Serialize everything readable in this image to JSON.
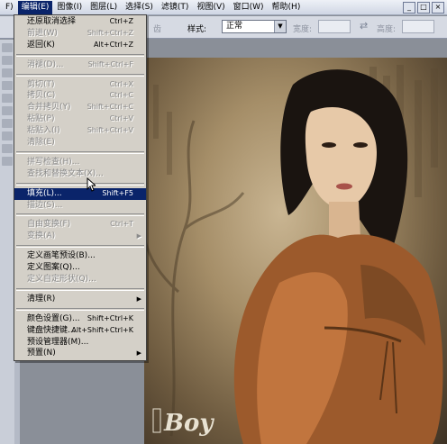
{
  "menubar": {
    "items": [
      {
        "label": "F)"
      },
      {
        "label": "编辑(E)"
      },
      {
        "label": "图像(I)"
      },
      {
        "label": "图层(L)"
      },
      {
        "label": "选择(S)"
      },
      {
        "label": "滤镜(T)"
      },
      {
        "label": "视图(V)"
      },
      {
        "label": "窗口(W)"
      },
      {
        "label": "帮助(H)"
      }
    ]
  },
  "options": {
    "cut_label": "齿",
    "style_label": "样式:",
    "style_value": "正常",
    "width_label": "宽度:",
    "height_label": "高度:"
  },
  "edit_menu": {
    "items": [
      {
        "label": "还原取消选择",
        "shortcut": "Ctrl+Z",
        "disabled": false
      },
      {
        "label": "前进(W)",
        "shortcut": "Shift+Ctrl+Z",
        "disabled": true
      },
      {
        "label": "返回(K)",
        "shortcut": "Alt+Ctrl+Z",
        "disabled": false
      },
      {
        "sep": true
      },
      {
        "label": "消褪(D)...",
        "shortcut": "Shift+Ctrl+F",
        "disabled": true
      },
      {
        "sep": true
      },
      {
        "label": "剪切(T)",
        "shortcut": "Ctrl+X",
        "disabled": true
      },
      {
        "label": "拷贝(C)",
        "shortcut": "Ctrl+C",
        "disabled": true
      },
      {
        "label": "合并拷贝(Y)",
        "shortcut": "Shift+Ctrl+C",
        "disabled": true
      },
      {
        "label": "粘贴(P)",
        "shortcut": "Ctrl+V",
        "disabled": true
      },
      {
        "label": "粘贴入(I)",
        "shortcut": "Shift+Ctrl+V",
        "disabled": true
      },
      {
        "label": "清除(E)",
        "shortcut": "",
        "disabled": true
      },
      {
        "sep": true
      },
      {
        "label": "拼写检查(H)...",
        "shortcut": "",
        "disabled": true
      },
      {
        "label": "查找和替换文本(X)...",
        "shortcut": "",
        "disabled": true
      },
      {
        "sep": true
      },
      {
        "label": "填充(L)...",
        "shortcut": "Shift+F5",
        "disabled": false,
        "highlight": true
      },
      {
        "label": "描边(S)...",
        "shortcut": "",
        "disabled": true
      },
      {
        "sep": true
      },
      {
        "label": "自由变换(F)",
        "shortcut": "Ctrl+T",
        "disabled": true
      },
      {
        "label": "变换(A)",
        "shortcut": "",
        "disabled": true,
        "submenu": true
      },
      {
        "sep": true
      },
      {
        "label": "定义画笔预设(B)...",
        "shortcut": "",
        "disabled": false
      },
      {
        "label": "定义图案(Q)...",
        "shortcut": "",
        "disabled": false
      },
      {
        "label": "定义自定形状(Q)...",
        "shortcut": "",
        "disabled": true
      },
      {
        "sep": true
      },
      {
        "label": "清理(R)",
        "shortcut": "",
        "disabled": false,
        "submenu": true
      },
      {
        "sep": true
      },
      {
        "label": "颜色设置(G)...",
        "shortcut": "Shift+Ctrl+K",
        "disabled": false
      },
      {
        "label": "键盘快捷键...",
        "shortcut": "Alt+Shift+Ctrl+K",
        "disabled": false
      },
      {
        "label": "预设管理器(M)...",
        "shortcut": "",
        "disabled": false
      },
      {
        "label": "预置(N)",
        "shortcut": "",
        "disabled": false,
        "submenu": true
      }
    ]
  },
  "watermark": {
    "text": "Boy"
  },
  "colors": {
    "highlight": "#0a246a",
    "menu_bg": "#d4d0c8"
  }
}
